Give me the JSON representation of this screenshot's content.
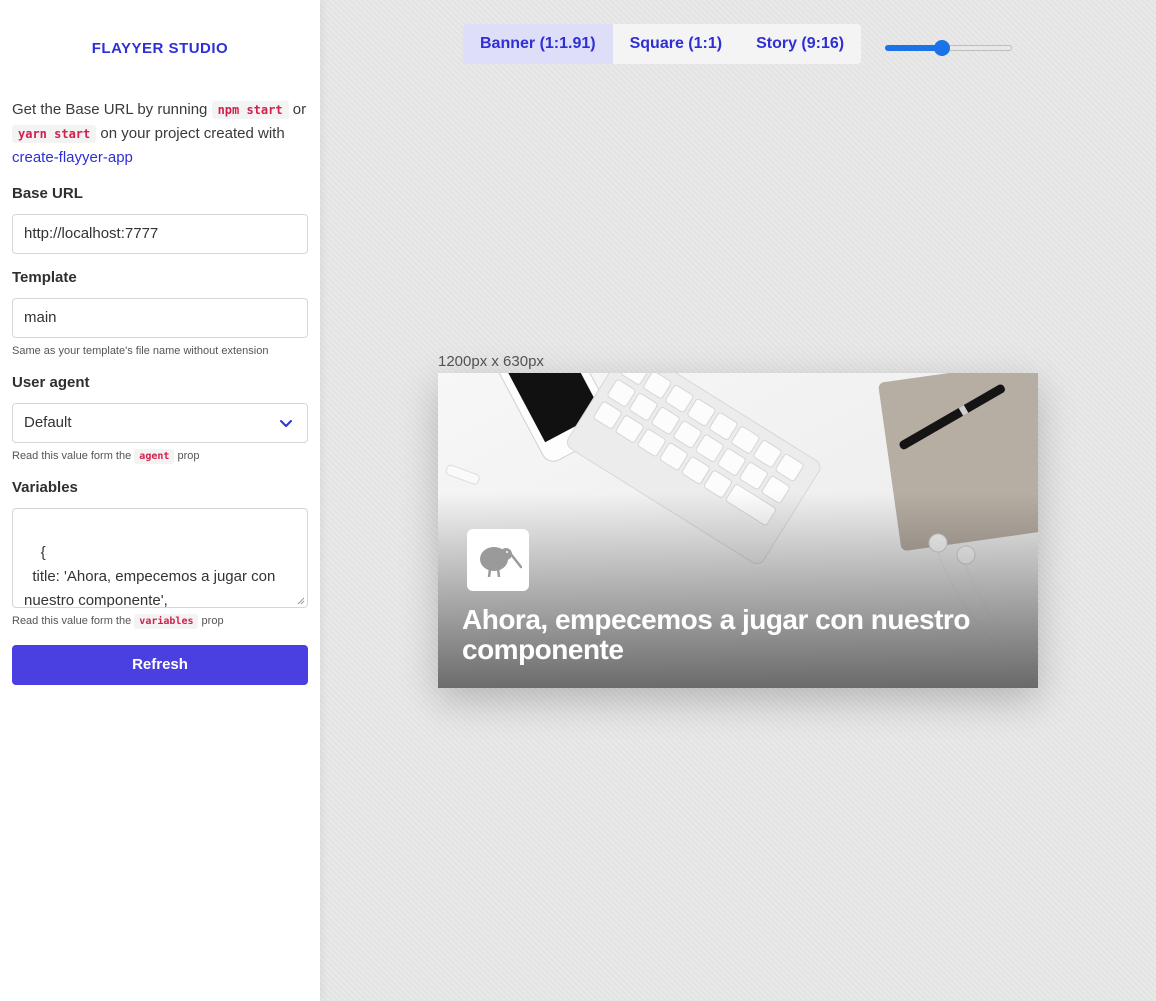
{
  "brand": "FLAYYER STUDIO",
  "intro": {
    "text1": "Get the Base URL by running ",
    "code1": "npm start",
    "text2": " or ",
    "code2": "yarn start",
    "text3": " on your project created with ",
    "link": "create-flayyer-app"
  },
  "fields": {
    "base_url_label": "Base URL",
    "base_url_value": "http://localhost:7777",
    "template_label": "Template",
    "template_value": "main",
    "template_help": "Same as your template's file name without extension",
    "agent_label": "User agent",
    "agent_value": "Default",
    "agent_help_text": "Read this value form the ",
    "agent_help_code": "agent",
    "agent_help_suffix": " prop",
    "variables_label": "Variables",
    "variables_value": "{\n  title: 'Ahora, empecemos a jugar con nuestro componente',\n}",
    "variables_help_text": "Read this value form the ",
    "variables_help_code": "variables",
    "variables_help_suffix": " prop",
    "refresh_label": "Refresh"
  },
  "tabs": [
    {
      "label": "Banner (1:1.91)",
      "active": true
    },
    {
      "label": "Square (1:1)",
      "active": false
    },
    {
      "label": "Story (9:16)",
      "active": false
    }
  ],
  "zoom": 0.45,
  "preview": {
    "dimensions": "1200px x 630px",
    "title": "Ahora, empecemos a jugar con nuestro componente"
  },
  "colors": {
    "accent": "#2f2fd6",
    "button": "#4a3fe0",
    "code": "#d21f4b"
  }
}
